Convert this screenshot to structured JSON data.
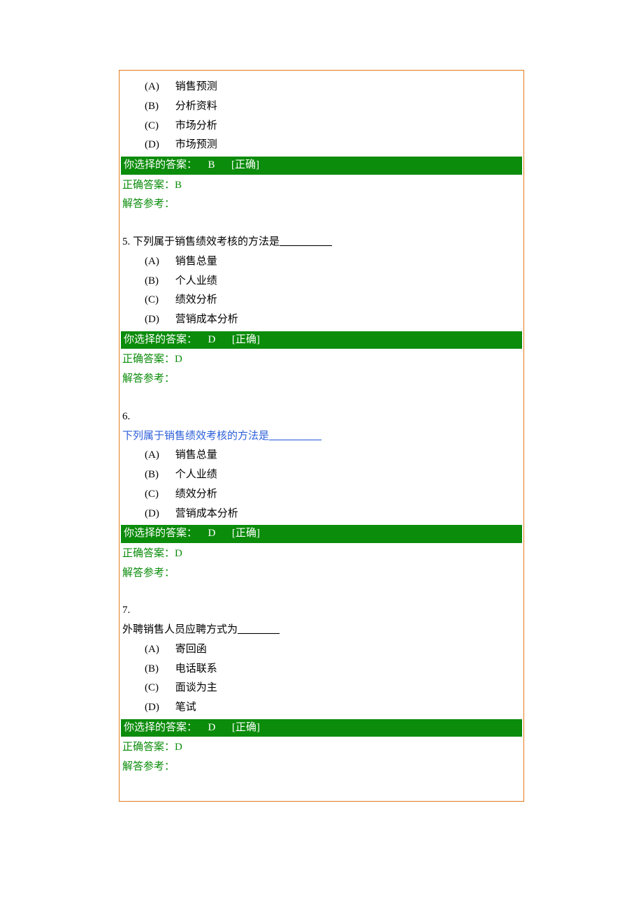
{
  "labels": {
    "your_choice_prefix": "你选择的答案：",
    "status_correct": "[正确]",
    "correct_answer_prefix": "正确答案：",
    "explain_prefix": "解答参考：",
    "blank": "__________",
    "blank_short": "________"
  },
  "q4": {
    "options": {
      "a_letter": "(A)",
      "a_text": "销售预测",
      "b_letter": "(B)",
      "b_text": "分析资料",
      "c_letter": "(C)",
      "c_text": "市场分析",
      "d_letter": "(D)",
      "d_text": "市场预测"
    },
    "chosen": "B",
    "correct": "B"
  },
  "q5": {
    "number": "5.",
    "text": "下列属于销售绩效考核的方法是",
    "options": {
      "a_letter": "(A)",
      "a_text": "销售总量",
      "b_letter": "(B)",
      "b_text": "个人业绩",
      "c_letter": "(C)",
      "c_text": "绩效分析",
      "d_letter": "(D)",
      "d_text": "营销成本分析"
    },
    "chosen": "D",
    "correct": "D"
  },
  "q6": {
    "number": "6.",
    "text": "下列属于销售绩效考核的方法是",
    "options": {
      "a_letter": "(A)",
      "a_text": "销售总量",
      "b_letter": "(B)",
      "b_text": "个人业绩",
      "c_letter": "(C)",
      "c_text": "绩效分析",
      "d_letter": "(D)",
      "d_text": "营销成本分析"
    },
    "chosen": "D",
    "correct": "D"
  },
  "q7": {
    "number": "7.",
    "text": "外聘销售人员应聘方式为",
    "options": {
      "a_letter": "(A)",
      "a_text": "寄回函",
      "b_letter": "(B)",
      "b_text": "电话联系",
      "c_letter": "(C)",
      "c_text": "面谈为主",
      "d_letter": "(D)",
      "d_text": "笔试"
    },
    "chosen": "D",
    "correct": "D"
  }
}
